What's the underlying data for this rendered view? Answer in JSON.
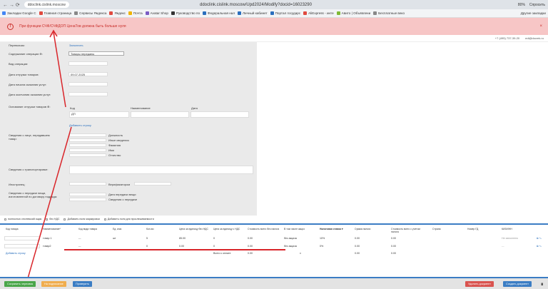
{
  "browser": {
    "nav_glyphs": "←  →  ⟳",
    "site_pill": "ddoclink.cislink.moscow",
    "url": "ddoclink.cislink.moscow/Upd2024/Modify?docid=16023290",
    "zoom": "80%",
    "speak": "Спросить"
  },
  "bookmarks": {
    "items": [
      {
        "label": "Закладки Google C",
        "color": "#4285f4"
      },
      {
        "label": "Главная страница",
        "color": "#e04a3f"
      },
      {
        "label": "Сервисы Яндекса",
        "color": "#888"
      },
      {
        "label": "Яндекс",
        "color": "#e04a3f"
      },
      {
        "label": "Почта",
        "color": "#f0b400"
      },
      {
        "label": "Avatar Shop",
        "color": "#7a5cc4"
      },
      {
        "label": "Руководство по",
        "color": "#333"
      },
      {
        "label": "Федеральная нал",
        "color": "#2a6fbd"
      },
      {
        "label": "Личный кабинет",
        "color": "#2a6fbd"
      },
      {
        "label": "Портал государс",
        "color": "#2a6fbd"
      },
      {
        "label": "AliExpress - инте",
        "color": "#e04a3f"
      },
      {
        "label": "Авито | Объявлени",
        "color": "#7fb935"
      },
      {
        "label": "Бесплатные веко",
        "color": "#888"
      }
    ],
    "other": "Другие закладки"
  },
  "alert": {
    "icon": "!",
    "message": "При функции СЧФ/СЧФДОП ЦенаТов должна быть больше нуля",
    "close": "×"
  },
  "contacts": {
    "phone": "+7 (495) 737-39-20",
    "email": "edi@docmk.ru"
  },
  "form": {
    "perevozchik": "Перевозчик:",
    "zapolnit": "Заполнить",
    "soderzhanie_label": "Содержание операции ⊕:",
    "soderzhanie_value": "Товары переданы",
    "vid_operacii": "Вид операции:",
    "data_otgruzki_label": "Дата отгрузки товаров:",
    "data_otgruzki_value": "09.07.2025",
    "data_nachala": "Дата начала оказания услуг:",
    "data_okonchaniya": "Дата окончания оказания услуг:",
    "osnovanie_label": "Основание отгрузки товаров ⊕:",
    "col_code": "Код",
    "col_name": "Наименование",
    "col_date": "Дата",
    "osnovanie_code_value": "ДП",
    "dobavit_stroku": "Добавить строку",
    "lico_label": "Сведения о лице, передавшем товар:",
    "dolzhnost": "Должность",
    "inye_svedeniya": "Иные сведения",
    "familiya": "Фамилия",
    "imya": "Имя",
    "otchestvo": "Отчество",
    "transport": "Сведения о транспортировке:",
    "inostranec": "Иностранец:",
    "verifikaciya": "Верификатором",
    "peredacha_label": "Сведения о передаче вещи, изготовленной по договору подряда:",
    "data_peredachi": "Дата передачи вещи",
    "svedeniya_peredache": "Сведения о передаче"
  },
  "checkboxes": [
    "полностью стилевский ящик",
    "без НДС",
    "Добавить поля маркировки",
    "Добавить поля для прослеживаемости"
  ],
  "table": {
    "headers": [
      "Код товара",
      "Наименование*",
      "Код вида товара",
      "Ед. изм.",
      "Кол-во",
      "Цена за единицу без НДС",
      "Цена за единицу с НДС",
      "Стоимость всего без налога",
      "В том числе акциз",
      "Налоговая ставка ▾",
      "Сумма налога",
      "Стоимость всего с учетом налога",
      "Страна",
      "Номер ГД",
      "КИЗ/ИНН"
    ],
    "rows": [
      {
        "code": "",
        "name": "товар 1",
        "kind": "---",
        "unit": "шт",
        "qty": "5",
        "price": "85.00",
        "price_vat": "0",
        "total_novat": "0.00",
        "excise": "без акциза",
        "rate": "10%",
        "tax": "0.00",
        "total": "0.00",
        "country": "",
        "gd": "",
        "kiz": "Не заполнено"
      },
      {
        "code": "",
        "name": "товар2",
        "kind": "---",
        "unit": "",
        "qty": "0",
        "price": "0.00",
        "price_vat": "0",
        "total_novat": "0.00",
        "excise": "без акциза",
        "rate": "0%",
        "tax": "0.00",
        "total": "0.00",
        "country": "",
        "gd": "",
        "kiz": "---"
      }
    ],
    "add_row": "Добавить строку",
    "total_label": "Всего к оплате",
    "total_sum": "0.00",
    "total_x": "x",
    "total_tax": "0.00",
    "total_all": "0.00"
  },
  "footer": {
    "save": "Сохранить черновик",
    "sign": "На подписание",
    "validate": "Проверить",
    "delete": "Удалить документ",
    "create": "Создать документ",
    "user_icon_label": "∎"
  }
}
